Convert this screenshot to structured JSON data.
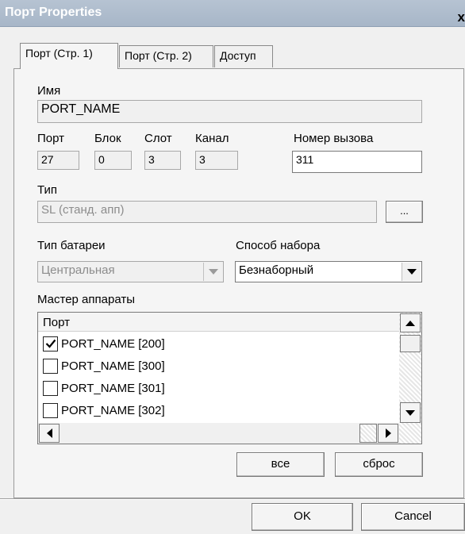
{
  "window": {
    "title": "Порт Properties",
    "close_glyph": "x"
  },
  "tabs": [
    {
      "label": "Порт (Стр. 1)",
      "active": true
    },
    {
      "label": "Порт (Стр. 2)",
      "active": false
    },
    {
      "label": "Доступ",
      "active": false
    }
  ],
  "name": {
    "label": "Имя",
    "value": "PORT_NAME"
  },
  "port": {
    "label": "Порт",
    "value": "27"
  },
  "block": {
    "label": "Блок",
    "value": "0"
  },
  "slot": {
    "label": "Слот",
    "value": "3"
  },
  "channel": {
    "label": "Канал",
    "value": "3"
  },
  "call_number": {
    "label": "Номер вызова",
    "value": "311"
  },
  "type": {
    "label": "Тип",
    "value": "SL (станд. апп)",
    "browse_label": "..."
  },
  "battery": {
    "label": "Тип батареи",
    "value": "Центральная"
  },
  "dial": {
    "label": "Способ набора",
    "value": "Безнаборный"
  },
  "masters": {
    "label": "Мастер аппараты",
    "column": "Порт",
    "rows": [
      {
        "label": "PORT_NAME [200]",
        "checked": true
      },
      {
        "label": "PORT_NAME [300]",
        "checked": false
      },
      {
        "label": "PORT_NAME [301]",
        "checked": false
      },
      {
        "label": "PORT_NAME [302]",
        "checked": false
      }
    ]
  },
  "buttons": {
    "all": "все",
    "reset": "сброс",
    "ok": "OK",
    "cancel": "Cancel"
  },
  "icons": {
    "close": "close-icon",
    "combo": "chevron-down-icon",
    "scroll_up": "arrow-up-icon",
    "scroll_down": "arrow-down-icon",
    "scroll_left": "arrow-left-icon",
    "scroll_right": "arrow-right-icon",
    "check": "checkmark-icon"
  },
  "colors": {
    "titlebar": "#aebbcc",
    "dialog_bg": "#f0f0f0",
    "field_bg": "#ffffff"
  }
}
